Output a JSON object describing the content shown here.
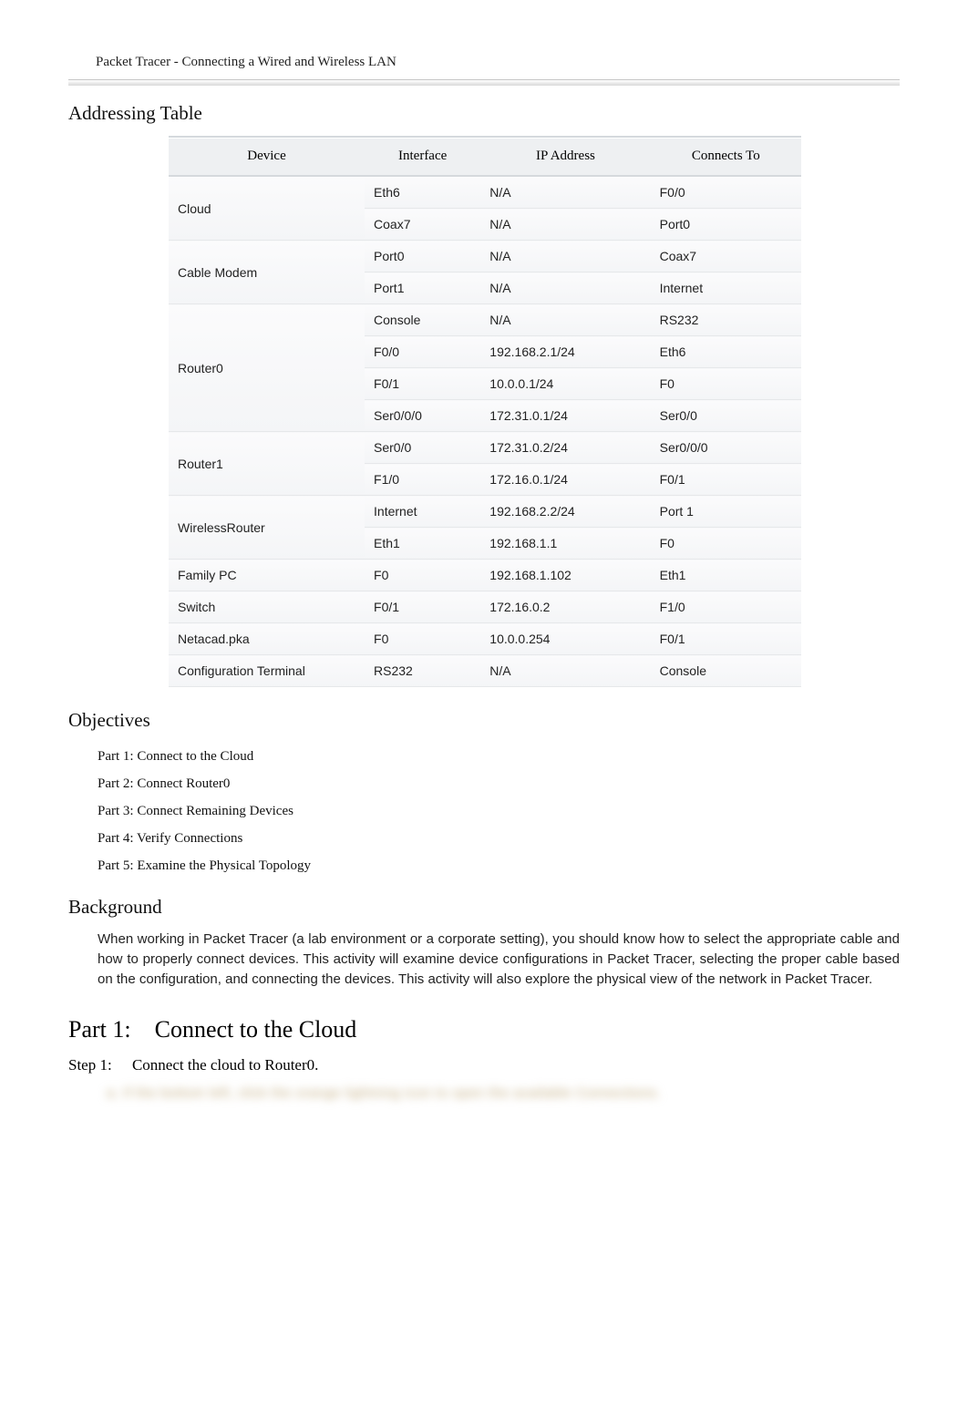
{
  "header": {
    "title": "Packet Tracer - Connecting a Wired and Wireless LAN"
  },
  "sections": {
    "addressing_table_title": "Addressing Table",
    "objectives_title": "Objectives",
    "background_title": "Background",
    "part1_title_prefix": "Part 1:",
    "part1_title": "Connect to the Cloud",
    "step1_label": "Step 1:",
    "step1_text": "Connect the cloud to Router0."
  },
  "table": {
    "headers": {
      "device": "Device",
      "interface": "Interface",
      "ip": "IP Address",
      "connects": "Connects  To"
    },
    "rows": [
      {
        "device": "Cloud",
        "rowspan": 2,
        "interface": "Eth6",
        "ip": "N/A",
        "connects": "F0/0"
      },
      {
        "device": "",
        "interface": "Coax7",
        "ip": "N/A",
        "connects": "Port0"
      },
      {
        "device": "Cable  Modem",
        "rowspan": 2,
        "interface": "Port0",
        "ip": "N/A",
        "connects": "Coax7"
      },
      {
        "device": "",
        "interface": "Port1",
        "ip": "N/A",
        "connects": "Internet"
      },
      {
        "device": "Router0",
        "rowspan": 4,
        "interface": "Console",
        "ip": "N/A",
        "connects": "RS232"
      },
      {
        "device": "",
        "interface": "F0/0",
        "ip": "192.168.2.1/24",
        "connects": "Eth6"
      },
      {
        "device": "",
        "interface": "F0/1",
        "ip": "10.0.0.1/24",
        "connects": "F0"
      },
      {
        "device": "",
        "interface": "Ser0/0/0",
        "ip": "172.31.0.1/24",
        "connects": "Ser0/0"
      },
      {
        "device": "Router1",
        "rowspan": 2,
        "interface": "Ser0/0",
        "ip": "172.31.0.2/24",
        "connects": "Ser0/0/0"
      },
      {
        "device": "",
        "interface": "F1/0",
        "ip": "172.16.0.1/24",
        "connects": "F0/1"
      },
      {
        "device": "WirelessRouter",
        "rowspan": 2,
        "interface": "Internet",
        "ip": "192.168.2.2/24",
        "connects": "Port 1"
      },
      {
        "device": "",
        "interface": "Eth1",
        "ip": "192.168.1.1",
        "connects": "F0"
      },
      {
        "device": "Family PC",
        "rowspan": 1,
        "interface": "F0",
        "ip": "192.168.1.102",
        "connects": "Eth1"
      },
      {
        "device": "Switch",
        "rowspan": 1,
        "interface": "F0/1",
        "ip": "172.16.0.2",
        "connects": "F1/0"
      },
      {
        "device": "Netacad.pka",
        "rowspan": 1,
        "interface": "F0",
        "ip": "10.0.0.254",
        "connects": "F0/1"
      },
      {
        "device": "Configuration  Terminal",
        "rowspan": 1,
        "interface": "RS232",
        "ip": "N/A",
        "connects": "Console"
      }
    ]
  },
  "objectives": [
    "Part 1: Connect to the Cloud",
    "Part 2: Connect Router0",
    "Part 3: Connect Remaining Devices",
    "Part 4: Verify Connections",
    "Part 5: Examine the Physical Topology"
  ],
  "background_text": "When working in Packet Tracer (a lab environment or a corporate setting), you should know how to select the appropriate cable and how to properly connect devices. This activity will examine device configurations in Packet Tracer, selecting the proper cable based on the configuration, and connecting the devices. This activity will also explore the physical view of the network in Packet Tracer.",
  "blurred_hint": "a.  If the bottom left, click the orange lightning icon to open the available  Connections."
}
